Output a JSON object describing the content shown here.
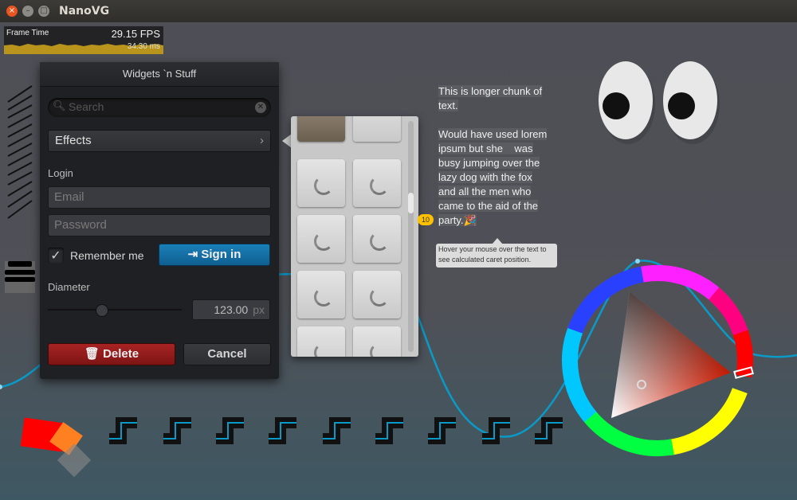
{
  "window": {
    "title": "NanoVG",
    "close_glyph": "×",
    "min_glyph": "–",
    "max_glyph": "□"
  },
  "perf": {
    "label": "Frame Time",
    "fps": "29.15 FPS",
    "ms": "34.30 ms"
  },
  "panel": {
    "title": "Widgets `n Stuff",
    "search_placeholder": "Search",
    "effects_label": "Effects",
    "login_label": "Login",
    "email_placeholder": "Email",
    "password_placeholder": "Password",
    "remember_label": "Remember me",
    "remember_checked": true,
    "signin_label": "Sign in",
    "diameter_label": "Diameter",
    "diameter_value": "123.00",
    "diameter_unit": "px",
    "slider_value": 0.4,
    "delete_label": "Delete",
    "cancel_label": "Cancel"
  },
  "paragraph": {
    "lines": [
      "This is longer chunk of",
      "text.",
      "",
      "Would have used lorem",
      "ipsum but she    was",
      "busy jumping over the",
      "lazy dog with the fox",
      "and all the men who",
      "came to the aid of the",
      "party.🎉"
    ],
    "line_badge": "10",
    "tooltip": "Hover your mouse over the text to see calculated caret position."
  },
  "colors": {
    "accent": "#1a7fb8",
    "danger": "#a82323",
    "badge": "#ffc000",
    "graph": "#b8941c"
  }
}
